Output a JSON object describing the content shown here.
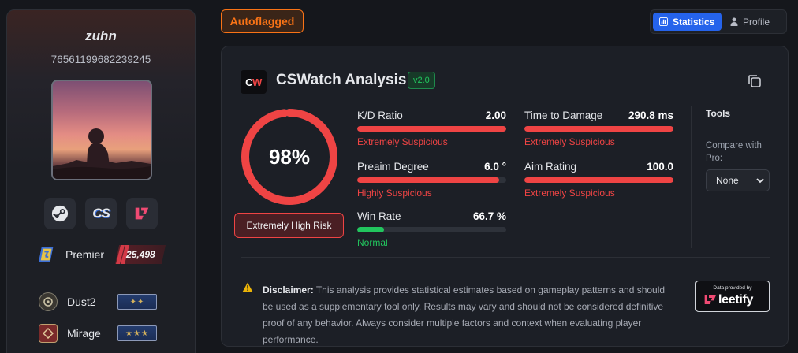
{
  "profile": {
    "username": "zuhn",
    "steam_id": "76561199682239245",
    "social": [
      {
        "name": "steam-icon"
      },
      {
        "name": "csstats-icon",
        "text": "CS"
      },
      {
        "name": "leetify-icon"
      }
    ],
    "premier": {
      "label": "Premier",
      "rating": "25,498"
    },
    "maps": [
      {
        "name": "Dust2",
        "rank_glyph": "✦✦"
      },
      {
        "name": "Mirage",
        "rank_glyph": "★★★"
      }
    ]
  },
  "header": {
    "flag_label": "Autoflagged",
    "tabs": [
      {
        "label": "Statistics",
        "icon": "bar-chart-icon",
        "active": true
      },
      {
        "label": "Profile",
        "icon": "user-icon",
        "active": false
      }
    ]
  },
  "analysis": {
    "logo_text_c": "C",
    "logo_text_w": "W",
    "title": "CSWatch Analysis",
    "version": "v2.0",
    "score": "98%",
    "score_fraction": 0.98,
    "risk_label": "Extremely High Risk",
    "metrics": [
      {
        "label": "K/D Ratio",
        "value": "2.00",
        "fill": 1.0,
        "status": "Extremely Suspicious",
        "level": "red"
      },
      {
        "label": "Time to Damage",
        "value": "290.8 ms",
        "fill": 1.0,
        "status": "Extremely Suspicious",
        "level": "red"
      },
      {
        "label": "Preaim Degree",
        "value": "6.0 °",
        "fill": 0.95,
        "status": "Highly Suspicious",
        "level": "red"
      },
      {
        "label": "Aim Rating",
        "value": "100.0",
        "fill": 1.0,
        "status": "Extremely Suspicious",
        "level": "red"
      },
      {
        "label": "Win Rate",
        "value": "66.7 %",
        "fill": 0.18,
        "status": "Normal",
        "level": "green"
      }
    ],
    "tools": {
      "title": "Tools",
      "compare_label": "Compare with Pro:",
      "compare_value": "None"
    },
    "disclaimer": {
      "title": "Disclaimer:",
      "text": "This analysis provides statistical estimates based on gameplay patterns and should be used as a supplementary tool only. Results may vary and should not be considered definitive proof of any behavior. Always consider multiple factors and context when evaluating player performance."
    },
    "provider": {
      "caption": "Data provided by",
      "name": "leetify"
    }
  },
  "colors": {
    "accent": "#2563eb",
    "danger": "#ef4444",
    "ok": "#22c55e",
    "flag": "#f97316"
  }
}
